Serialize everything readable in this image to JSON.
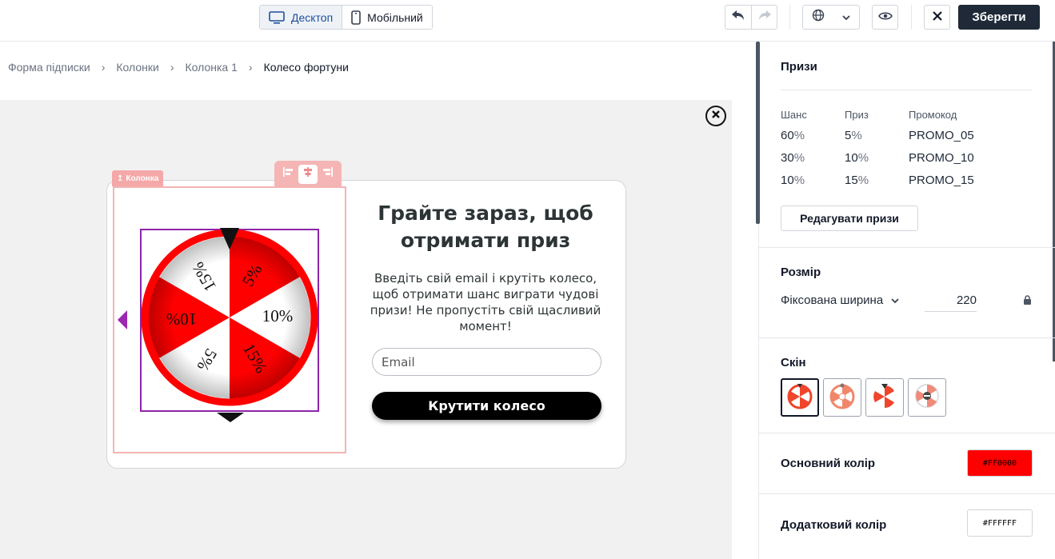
{
  "toolbar": {
    "device_desktop": "Десктоп",
    "device_mobile": "Мобільний",
    "save_label": "Зберегти"
  },
  "breadcrumb": [
    "Форма підписки",
    "Колонки",
    "Колонка 1",
    "Колесо фортуни"
  ],
  "canvas": {
    "column_tag": "Колонка",
    "headline": "Грайте зараз, щоб отримати приз",
    "description": "Введіть свій email і крутіть колесо, щоб отримати шанс виграти чудові призи! Не пропустіть свій щасливий момент!",
    "email_placeholder": "Email",
    "spin_button": "Крутити колесо",
    "wheel_segments": [
      "5%",
      "10%",
      "15%",
      "5%",
      "10%",
      "15%"
    ],
    "wheel_primary_color": "#FF0000",
    "wheel_secondary_color": "#FFFFFF"
  },
  "panel": {
    "prizes": {
      "title": "Призи",
      "headers": [
        "Шанс",
        "Приз",
        "Промокод"
      ],
      "rows": [
        {
          "chance": "60",
          "prize": "5",
          "code": "PROMO_05"
        },
        {
          "chance": "30",
          "prize": "10",
          "code": "PROMO_10"
        },
        {
          "chance": "10",
          "prize": "15",
          "code": "PROMO_15"
        }
      ],
      "pct_symbol": "%",
      "edit_button": "Редагувати призи"
    },
    "size": {
      "title": "Розмір",
      "mode": "Фіксована ширина",
      "value": "220"
    },
    "skin": {
      "title": "Скін",
      "options": [
        "skin-1",
        "skin-2",
        "skin-3",
        "skin-4"
      ]
    },
    "primary_color": {
      "label": "Основний колір",
      "value": "#FF0000"
    },
    "secondary_color": {
      "label": "Додатковий колір",
      "value": "#FFFFFF"
    }
  }
}
